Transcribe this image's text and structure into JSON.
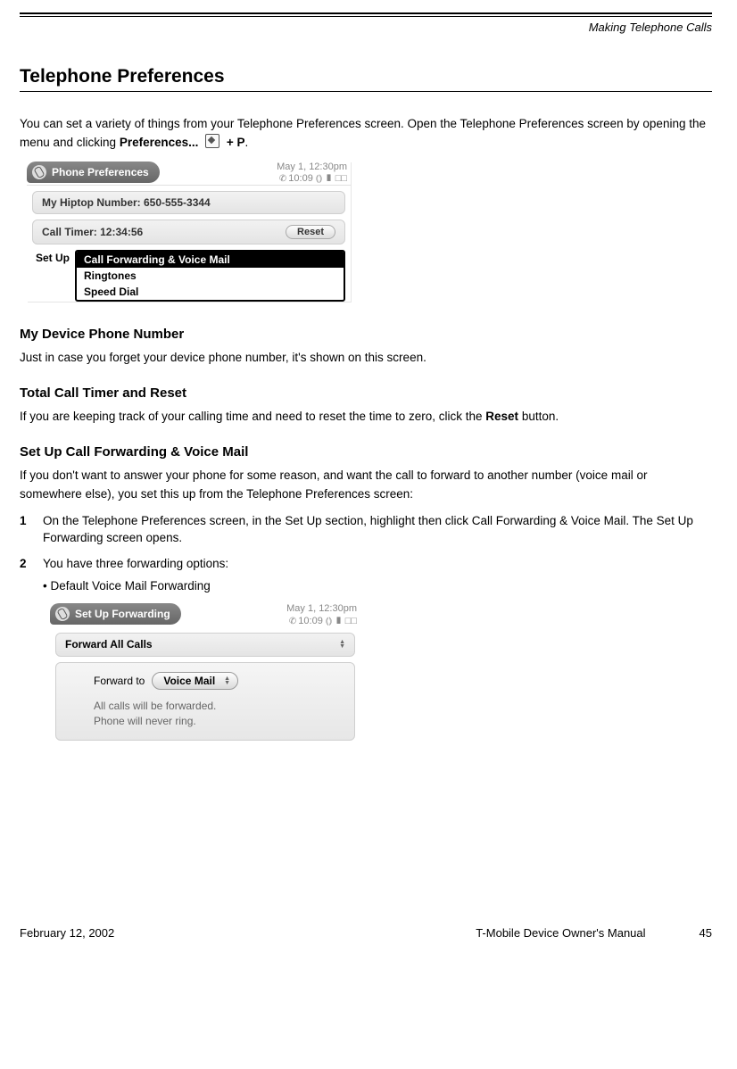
{
  "running_head": "Making Telephone Calls",
  "section_title": "Telephone Preferences",
  "intro_part1": "You can set a variety of things from your Telephone Preferences screen. Open the Telephone Preferences screen by opening the menu and clicking ",
  "intro_bold1": "Preferences... ",
  "intro_part2": " + P",
  "intro_period": ".",
  "screenshot1": {
    "title": "Phone Preferences",
    "date": "May 1, 12:30pm",
    "time": "10:09",
    "my_number_label": "My Hiptop Number: 650-555-3344",
    "call_timer_label": "Call Timer: 12:34:56",
    "reset": "Reset",
    "setup_label": "Set Up",
    "items": [
      "Call Forwarding & Voice Mail",
      "Ringtones",
      "Speed Dial"
    ]
  },
  "sub1_title": "My Device Phone Number",
  "sub1_body": "Just in case you forget your device phone number, it's shown on this screen.",
  "sub2_title": "Total Call Timer and Reset",
  "sub2_body_a": "If you are keeping track of your calling time and need to reset the time to zero, click the ",
  "sub2_body_bold": "Reset",
  "sub2_body_b": " button.",
  "sub3_title": "Set Up Call Forwarding & Voice Mail",
  "sub3_body": "If you don't want to answer your phone for some reason, and want the call to forward to another number (voice mail or somewhere else), you set this up from the Telephone Preferences screen:",
  "step1_a": "On the Telephone Preferences screen, in the Set Up section, highlight then click ",
  "step1_bold": "Call Forwarding & Voice Mail",
  "step1_b": ". The Set Up Forwarding screen opens.",
  "step2": "You have three forwarding options:",
  "bullet1": "Default Voice Mail Forwarding",
  "screenshot2": {
    "title": "Set Up Forwarding",
    "date": "May 1, 12:30pm",
    "time": "10:09",
    "mode": "Forward All Calls",
    "forward_to_label": "Forward to",
    "forward_to_value": "Voice Mail",
    "note1": "All calls will be forwarded.",
    "note2": "Phone will never ring."
  },
  "footer": {
    "date": "February 12, 2002",
    "center": "T-Mobile Device Owner's Manual",
    "page": "45"
  }
}
